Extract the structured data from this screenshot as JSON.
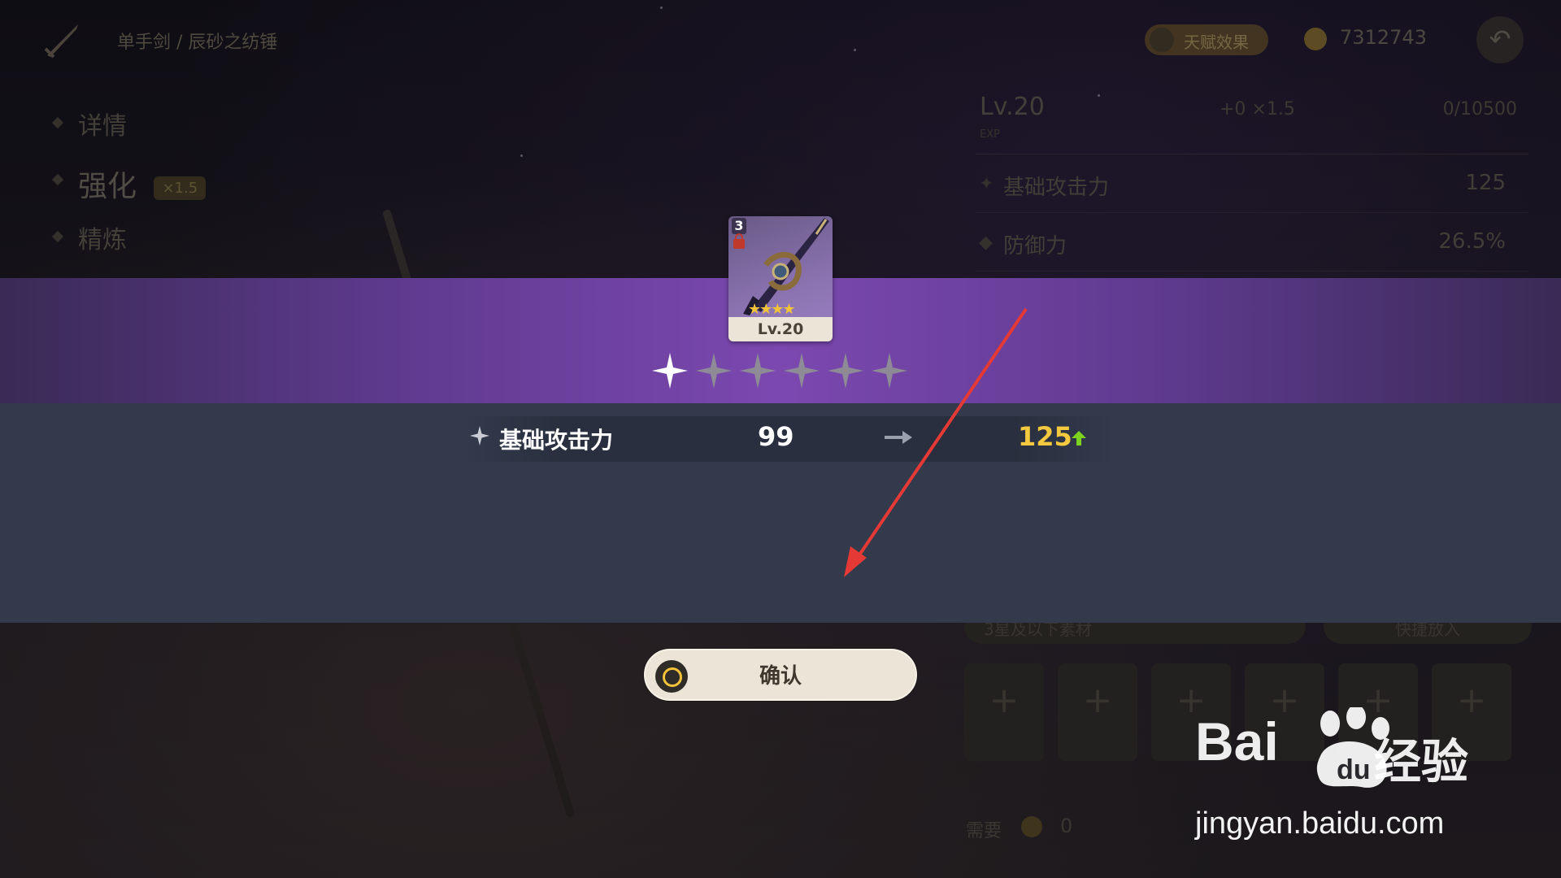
{
  "header": {
    "breadcrumb": "单手剑 / 辰砂之纺锤",
    "talent_button": "天赋效果",
    "coins": "7312743"
  },
  "side_menu": {
    "items": [
      {
        "label": "详情"
      },
      {
        "label": "强化",
        "badge": "×1.5"
      },
      {
        "label": "精炼"
      }
    ]
  },
  "stats_panel": {
    "level": "Lv.20",
    "exp_label": "EXP",
    "exp_bonus": "+0 ×1.5",
    "exp_progress": "0/10500",
    "stats": [
      {
        "name": "基础攻击力",
        "value": "125"
      },
      {
        "name": "防御力",
        "value": "26.5%"
      }
    ]
  },
  "materials": {
    "dropdown": "3星及以下素材",
    "quick_add": "快捷放入",
    "slot_symbol": "+",
    "need_label": "需要",
    "need_count": "0"
  },
  "result": {
    "card": {
      "refinement": "3",
      "rarity_stars": "★★★★",
      "level": "Lv.20"
    },
    "ascension_filled": 1,
    "ascension_total": 6,
    "stat_name": "基础攻击力",
    "old_value": "99",
    "new_value": "125",
    "confirm_label": "确认"
  },
  "watermark": {
    "logo": "Bai",
    "logo_cn": "经验",
    "url": "jingyan.baidu.com"
  },
  "colors": {
    "purple_band": "#7b48b0",
    "slate_band": "#323a4c",
    "highlight": "#f5c93f",
    "up_arrow": "#7ed321",
    "annotation": "#e53935"
  }
}
